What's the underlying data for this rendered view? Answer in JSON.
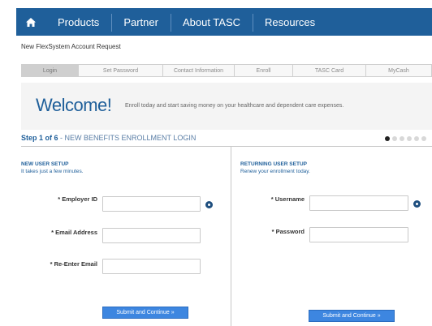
{
  "nav": {
    "home_icon": "home-icon",
    "items": [
      "Products",
      "Partner",
      "About TASC",
      "Resources"
    ]
  },
  "page_title": "New FlexSystem Account Request",
  "tabs": [
    "Login",
    "Set Password",
    "Contact Information",
    "Enroll",
    "TASC Card",
    "MyCash"
  ],
  "welcome": {
    "heading": "Welcome!",
    "text": "Enroll today and start saving money on your healthcare and dependent care expenses."
  },
  "step": {
    "prefix": "Step 1 of 6",
    "rest": " - NEW BENEFITS ENROLLMENT LOGIN",
    "current": 1,
    "total": 6
  },
  "new_user": {
    "title": "NEW USER SETUP",
    "subtitle": "It takes just a few minutes.",
    "employer_id_label": "* Employer ID",
    "email_label": "* Email Address",
    "reenter_email_label": "* Re-Enter Email",
    "employer_id_value": "",
    "email_value": "",
    "reenter_email_value": "",
    "submit": "Submit and Continue »"
  },
  "returning_user": {
    "title": "RETURNING USER SETUP",
    "subtitle": "Renew your enrollment today.",
    "username_label": "* Username",
    "password_label": "* Password",
    "username_value": "",
    "password_value": "",
    "submit": "Submit and Continue »"
  },
  "colors": {
    "nav_bg": "#1f5f9a",
    "accent": "#1f5f9a",
    "button": "#3d86e0"
  }
}
